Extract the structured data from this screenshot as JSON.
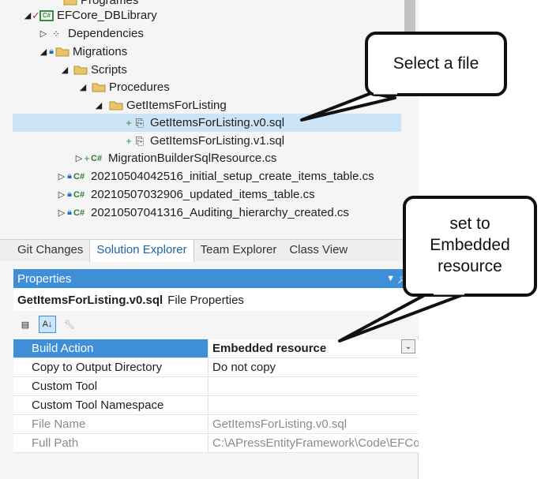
{
  "tree": {
    "rows": [
      {
        "label": "Programes"
      },
      {
        "label": "EFCore_DBLibrary",
        "proj_badge": "C#"
      },
      {
        "label": "Dependencies"
      },
      {
        "label": "Migrations"
      },
      {
        "label": "Scripts"
      },
      {
        "label": "Procedures"
      },
      {
        "label": "GetItemsForListing"
      },
      {
        "label": "GetItemsForListing.v0.sql"
      },
      {
        "label": "GetItemsForListing.v1.sql"
      },
      {
        "label": "MigrationBuilderSqlResource.cs",
        "badge": "C#"
      },
      {
        "label": "20210504042516_initial_setup_create_items_table.cs",
        "badge": "C#"
      },
      {
        "label": "20210507032906_updated_items_table.cs",
        "badge": "C#"
      },
      {
        "label": "20210507041316_Auditing_hierarchy_created.cs",
        "badge": "C#"
      }
    ]
  },
  "tabs": [
    "Git Changes",
    "Solution Explorer",
    "Team Explorer",
    "Class View"
  ],
  "properties": {
    "title": "Properties",
    "file_name": "GetItemsForListing.v0.sql",
    "file_type": "File Properties",
    "rows": [
      {
        "name": "Build Action",
        "value": "Embedded resource"
      },
      {
        "name": "Copy to Output Directory",
        "value": "Do not copy"
      },
      {
        "name": "Custom Tool",
        "value": ""
      },
      {
        "name": "Custom Tool Namespace",
        "value": ""
      },
      {
        "name": "File Name",
        "value": "GetItemsForListing.v0.sql"
      },
      {
        "name": "Full Path",
        "value": "C:\\APressEntityFramework\\Code\\EFCo"
      }
    ]
  },
  "callouts": {
    "select": "Select a file",
    "embedded_line1": "set to",
    "embedded_line2": "Embedded",
    "embedded_line3": "resource"
  },
  "colors": {
    "accent": "#3f8fd8",
    "selection": "#cce4f7"
  }
}
